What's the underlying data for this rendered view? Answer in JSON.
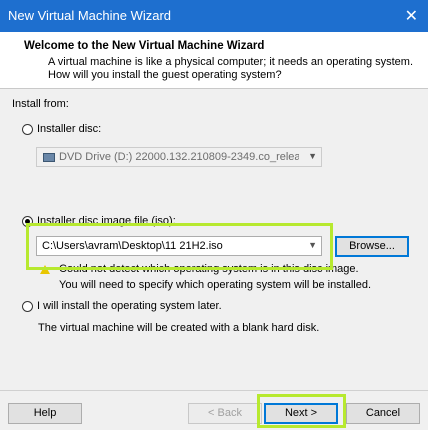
{
  "window": {
    "title": "New Virtual Machine Wizard",
    "close_glyph": "✕"
  },
  "header": {
    "title": "Welcome to the New Virtual Machine Wizard",
    "description": "A virtual machine is like a physical computer; it needs an operating system. How will you install the guest operating system?"
  },
  "install_from": {
    "label": "Install from:",
    "installer_disc": {
      "label": "Installer disc:",
      "selected": false,
      "drive_value": "DVD Drive (D:) 22000.132.210809-2349.co_releas"
    },
    "disc_image": {
      "label": "Installer disc image file (iso):",
      "selected": true,
      "path_value": "C:\\Users\\avram\\Desktop\\11 21H2.iso",
      "browse_label": "Browse...",
      "warning_line1": "Could not detect which operating system is in this disc image.",
      "warning_line2": "You will need to specify which operating system will be installed."
    },
    "install_later": {
      "label": "I will install the operating system later.",
      "selected": false,
      "description": "The virtual machine will be created with a blank hard disk."
    }
  },
  "footer": {
    "help_label": "Help",
    "back_label": "< Back",
    "next_label": "Next >",
    "cancel_label": "Cancel"
  },
  "colors": {
    "titlebar": "#1e6fcf",
    "highlight": "#b7e92f",
    "focus": "#0078d7"
  }
}
